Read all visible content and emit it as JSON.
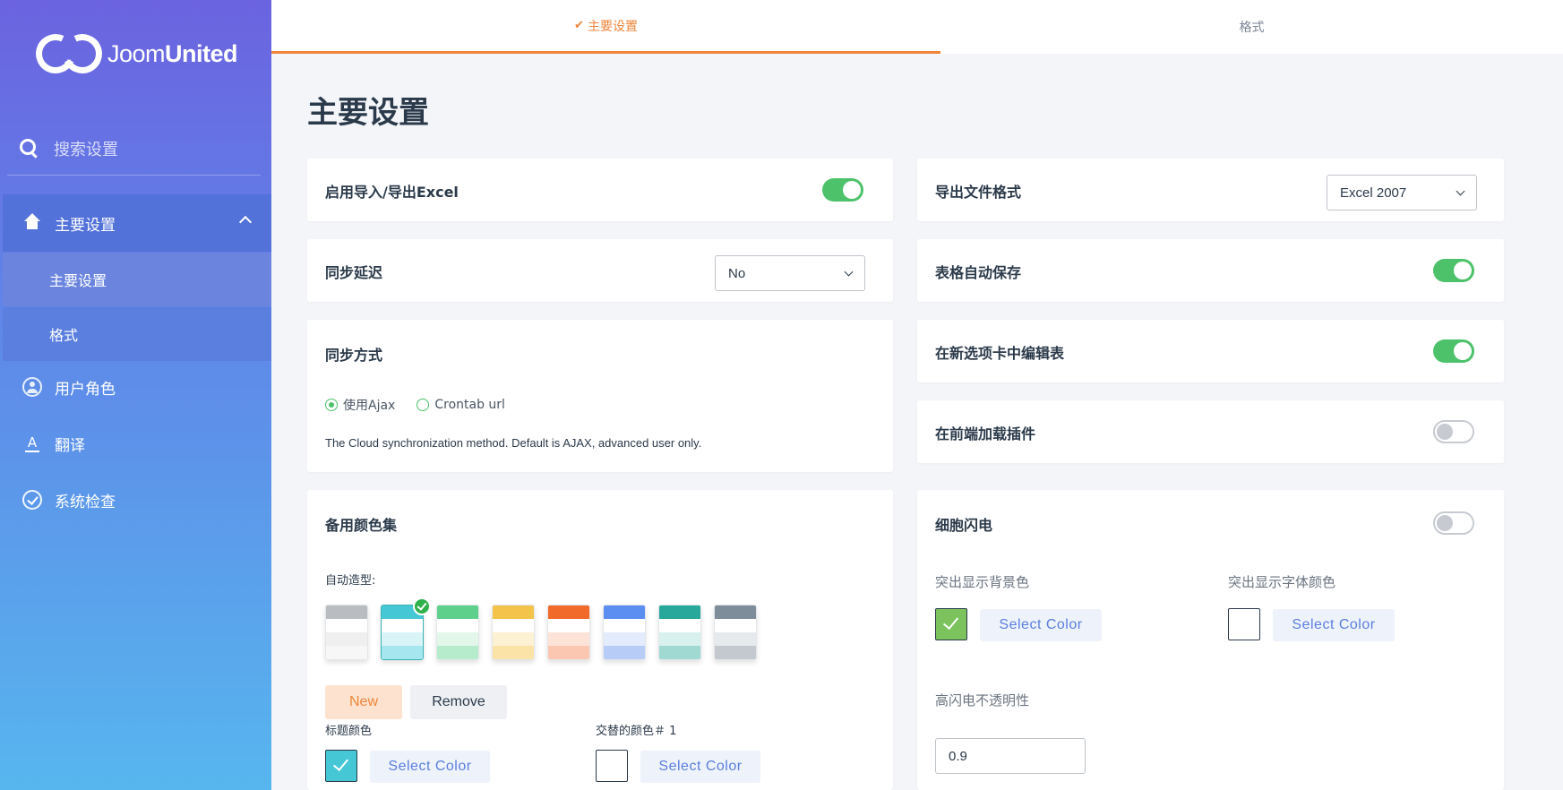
{
  "sidebar": {
    "logo": {
      "prefix": "Joom",
      "bold": "United"
    },
    "search": {
      "placeholder": "搜索设置"
    },
    "main_item": {
      "label": "主要设置",
      "icon": "home-icon"
    },
    "sub_items": [
      {
        "label": "主要设置"
      },
      {
        "label": "格式"
      }
    ],
    "items": [
      {
        "label": "用户角色",
        "icon": "user-circle-icon"
      },
      {
        "label": "翻译",
        "icon": "translate-icon"
      },
      {
        "label": "系统检查",
        "icon": "check-circle-icon"
      }
    ]
  },
  "tabs": [
    {
      "label": "主要设置",
      "active": true
    },
    {
      "label": "格式",
      "active": false
    }
  ],
  "page_title": "主要设置",
  "left": {
    "enable_excel": {
      "label": "启用导入/导出Excel",
      "on": true
    },
    "sync_delay": {
      "label": "同步延迟",
      "value": "No"
    },
    "sync_method": {
      "label": "同步方式",
      "options": [
        {
          "label": "使用Ajax",
          "selected": true
        },
        {
          "label": "Crontab url",
          "selected": false
        }
      ],
      "description": "The Cloud synchronization method. Default is AJAX, advanced user only."
    },
    "color_sets": {
      "label": "备用颜色集",
      "auto_style_label": "自动造型:",
      "swatches": [
        {
          "header": "#b9bcc0",
          "r2": "#efefef",
          "r3": "#f7f7f7"
        },
        {
          "header": "#45c7d6",
          "r2": "#d8f4f7",
          "r3": "#a6e6ee",
          "selected": true
        },
        {
          "header": "#5fd08c",
          "r2": "#e2f7ea",
          "r3": "#b6ebcb"
        },
        {
          "header": "#f3c34a",
          "r2": "#fdf1d3",
          "r3": "#fbe2a6"
        },
        {
          "header": "#f26a2a",
          "r2": "#fde3d7",
          "r3": "#fbc7b0"
        },
        {
          "header": "#5b8ef0",
          "r2": "#e3ecfd",
          "r3": "#b7cdf8"
        },
        {
          "header": "#27a89a",
          "r2": "#d9f1ee",
          "r3": "#9fd9d1"
        },
        {
          "header": "#7d8d99",
          "r2": "#e7eaec",
          "r3": "#c3c9ce"
        }
      ],
      "new_label": "New",
      "remove_label": "Remove",
      "header_color_label": "标题颜色",
      "header_color": "#45c7d6",
      "alt_color_label": "交替的颜色＃ 1",
      "select_color_label": "Select Color"
    }
  },
  "right": {
    "export_format": {
      "label": "导出文件格式",
      "value": "Excel 2007"
    },
    "autosave": {
      "label": "表格自动保存",
      "on": true
    },
    "edit_new_tab": {
      "label": "在新选项卡中编辑表",
      "on": true
    },
    "frontend_plugin": {
      "label": "在前端加载插件",
      "on": false
    },
    "cell_flash": {
      "label": "细胞闪电",
      "on": false,
      "bg_color_label": "突出显示背景色",
      "bg_color": "#7cc35e",
      "font_color_label": "突出显示字体颜色",
      "select_color_label": "Select Color",
      "opacity_label": "高闪电不透明性",
      "opacity_value": "0.9"
    }
  }
}
